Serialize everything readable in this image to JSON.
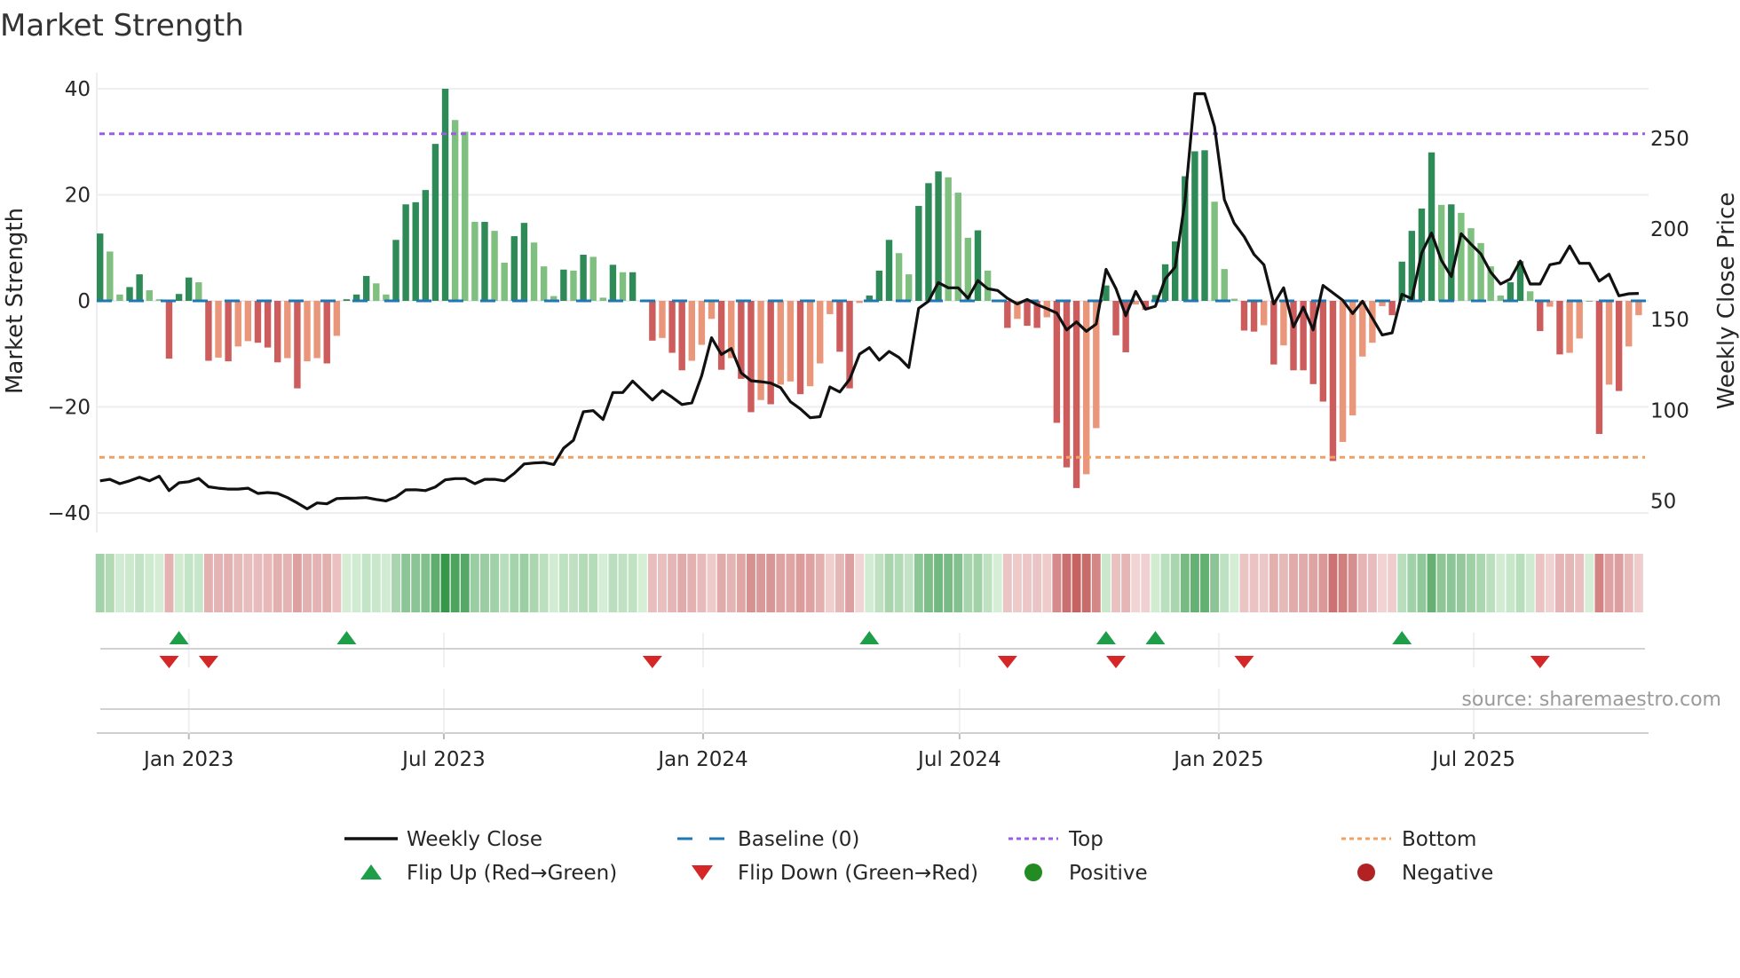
{
  "chart_data": {
    "type": "bar",
    "title": "Market Strength",
    "frequency": "weekly",
    "start_date": "2022-10-30",
    "strength": [
      12.7,
      9.3,
      1.2,
      2.6,
      5.0,
      2.0,
      0.3,
      -10.9,
      1.3,
      4.4,
      3.5,
      -11.3,
      -10.7,
      -11.4,
      -8.6,
      -7.6,
      -7.9,
      -8.8,
      -11.6,
      -10.8,
      -16.5,
      -11.4,
      -10.8,
      -11.8,
      -6.6,
      0.3,
      1.2,
      4.7,
      3.3,
      1.2,
      11.5,
      18.2,
      18.6,
      20.9,
      29.6,
      40.0,
      34.1,
      31.9,
      14.9,
      14.9,
      13.2,
      7.2,
      12.2,
      14.7,
      11.0,
      6.5,
      0.9,
      5.9,
      5.7,
      8.7,
      8.3,
      0.6,
      6.8,
      5.4,
      5.4,
      0,
      -7.5,
      -7.0,
      -9.8,
      -13.1,
      -11.3,
      -8.3,
      -3.4,
      -13.0,
      -10.8,
      -14.7,
      -21.0,
      -18.7,
      -19.5,
      -15.8,
      -15.2,
      -17.6,
      -16.1,
      -11.8,
      -2.5,
      -9.6,
      -16.5,
      -0.4,
      1.0,
      5.7,
      11.5,
      9.0,
      5.0,
      17.9,
      22.2,
      24.4,
      23.3,
      20.4,
      11.9,
      13.3,
      5.7,
      0,
      -5.1,
      -3.4,
      -4.7,
      -5.1,
      -3.1,
      -23.0,
      -31.4,
      -35.3,
      -32.7,
      -24.0,
      2.9,
      -6.5,
      -9.7,
      -0.7,
      -1.7,
      1.1,
      6.9,
      11.2,
      23.5,
      28.2,
      28.4,
      18.7,
      6.0,
      0.4,
      -5.6,
      -5.8,
      -4.6,
      -12.0,
      -8.4,
      -13.1,
      -13.1,
      -15.7,
      -19.0,
      -30.2,
      -26.6,
      -21.6,
      -10.5,
      -7.9,
      -1.0,
      -2.7,
      7.4,
      13.2,
      17.4,
      28.0,
      18.1,
      18.2,
      16.6,
      13.7,
      10.9,
      6.5,
      1.0,
      3.5,
      7.5,
      1.8,
      -5.7,
      -1.1,
      -10.1,
      -9.8,
      -7.1,
      0,
      -25.1,
      -15.8,
      -17.0,
      -8.6,
      -2.7
    ],
    "weekly_close": [
      60.6,
      61.4,
      59.0,
      60.6,
      62.6,
      60.6,
      63.1,
      55.2,
      59.5,
      60.1,
      61.9,
      57.3,
      56.5,
      56.0,
      56.0,
      56.5,
      53.6,
      54.1,
      53.6,
      51.3,
      48.4,
      45.1,
      48.4,
      47.9,
      50.8,
      51.0,
      51.1,
      51.3,
      50.3,
      49.5,
      51.6,
      55.6,
      55.7,
      55.2,
      57.2,
      61.1,
      61.8,
      61.8,
      59.0,
      61.4,
      61.4,
      60.6,
      64.7,
      69.9,
      70.4,
      70.7,
      69.6,
      78.6,
      83.0,
      98.7,
      99.3,
      94.4,
      109.3,
      109.3,
      115.6,
      110.4,
      105.2,
      110.4,
      106.7,
      102.7,
      103.6,
      118.6,
      139.5,
      130.3,
      133.6,
      120.2,
      115.8,
      115.3,
      114.5,
      112.0,
      104.2,
      100.3,
      95.4,
      96.0,
      112.4,
      109.6,
      116.6,
      130.5,
      134.1,
      127.2,
      132.0,
      128.7,
      123.1,
      155.8,
      159.7,
      170.0,
      167.1,
      167.1,
      161.3,
      171.1,
      166.6,
      165.6,
      161.3,
      158.2,
      160.7,
      157.8,
      155.6,
      153.2,
      143.9,
      148.3,
      143.1,
      147.1,
      177.3,
      166.7,
      151.7,
      165.1,
      155.3,
      156.9,
      172.1,
      178.5,
      214.9,
      274.2,
      274.2,
      256.0,
      215.7,
      202.7,
      195.3,
      185.5,
      179.8,
      158.2,
      167.1,
      145.5,
      156.4,
      143.9,
      168.4,
      164.3,
      160.2,
      152.9,
      159.7,
      150.4,
      141.1,
      142.2,
      163.5,
      161.0,
      186.3,
      197.3,
      182.2,
      173.3,
      196.9,
      191.2,
      185.8,
      175.7,
      169.2,
      172.0,
      181.9,
      169.2,
      169.2,
      179.8,
      180.9,
      190.1,
      180.6,
      180.6,
      170.8,
      174.6,
      162.7,
      163.8,
      164.0
    ],
    "top_level": 31.5,
    "bottom_level": -29.5,
    "baseline": 0,
    "flip_up_weeks": [
      8,
      25,
      78,
      102,
      107,
      132
    ],
    "flip_down_weeks": [
      7,
      11,
      56,
      92,
      103,
      116,
      146
    ],
    "y_left": {
      "label": "Market Strength",
      "range": [
        -42,
        42
      ],
      "ticks": [
        40,
        20,
        0,
        -20,
        -40
      ],
      "tick_labels": [
        "40",
        "20",
        "0",
        "−20",
        "−40"
      ]
    },
    "y_right": {
      "label": "Weekly Close Price",
      "ticks": [
        250,
        200,
        150,
        100,
        50
      ],
      "tick_labels": [
        "250",
        "200",
        "150",
        "100",
        "50"
      ]
    },
    "x_ticks": [
      {
        "label": "Jan 2023",
        "date": "2023-01-01"
      },
      {
        "label": "Jul 2023",
        "date": "2023-07-01"
      },
      {
        "label": "Jan 2024",
        "date": "2024-01-01"
      },
      {
        "label": "Jul 2024",
        "date": "2024-07-01"
      },
      {
        "label": "Jan 2025",
        "date": "2025-01-01"
      },
      {
        "label": "Jul 2025",
        "date": "2025-07-01"
      }
    ],
    "grid": true,
    "legend_placement": "bottom",
    "legend": [
      {
        "label": "Weekly Close",
        "symbol": "line"
      },
      {
        "label": "Baseline (0)",
        "symbol": "dashed"
      },
      {
        "label": "Top",
        "symbol": "dotted-top"
      },
      {
        "label": "Bottom",
        "symbol": "dotted-bottom"
      },
      {
        "label": "Flip Up (Red→Green)",
        "symbol": "triangle-up"
      },
      {
        "label": "Flip Down (Green→Red)",
        "symbol": "triangle-down"
      },
      {
        "label": "Positive",
        "symbol": "circle-positive"
      },
      {
        "label": "Negative",
        "symbol": "circle-negative"
      }
    ],
    "source": "source: sharemaestro.com"
  },
  "colors": {
    "pos_strong": "#2e8b57",
    "pos_weak": "#7fbf7f",
    "neg_strong": "#cd5c5c",
    "neg_weak": "#e9967a",
    "line": "#111111",
    "baseline": "#1f77b4",
    "top": "#9b5de5",
    "bottom": "#f0a060",
    "flip_up": "#1e9e48",
    "flip_down": "#d62728",
    "positive": "#228b22",
    "negative": "#b22222"
  }
}
